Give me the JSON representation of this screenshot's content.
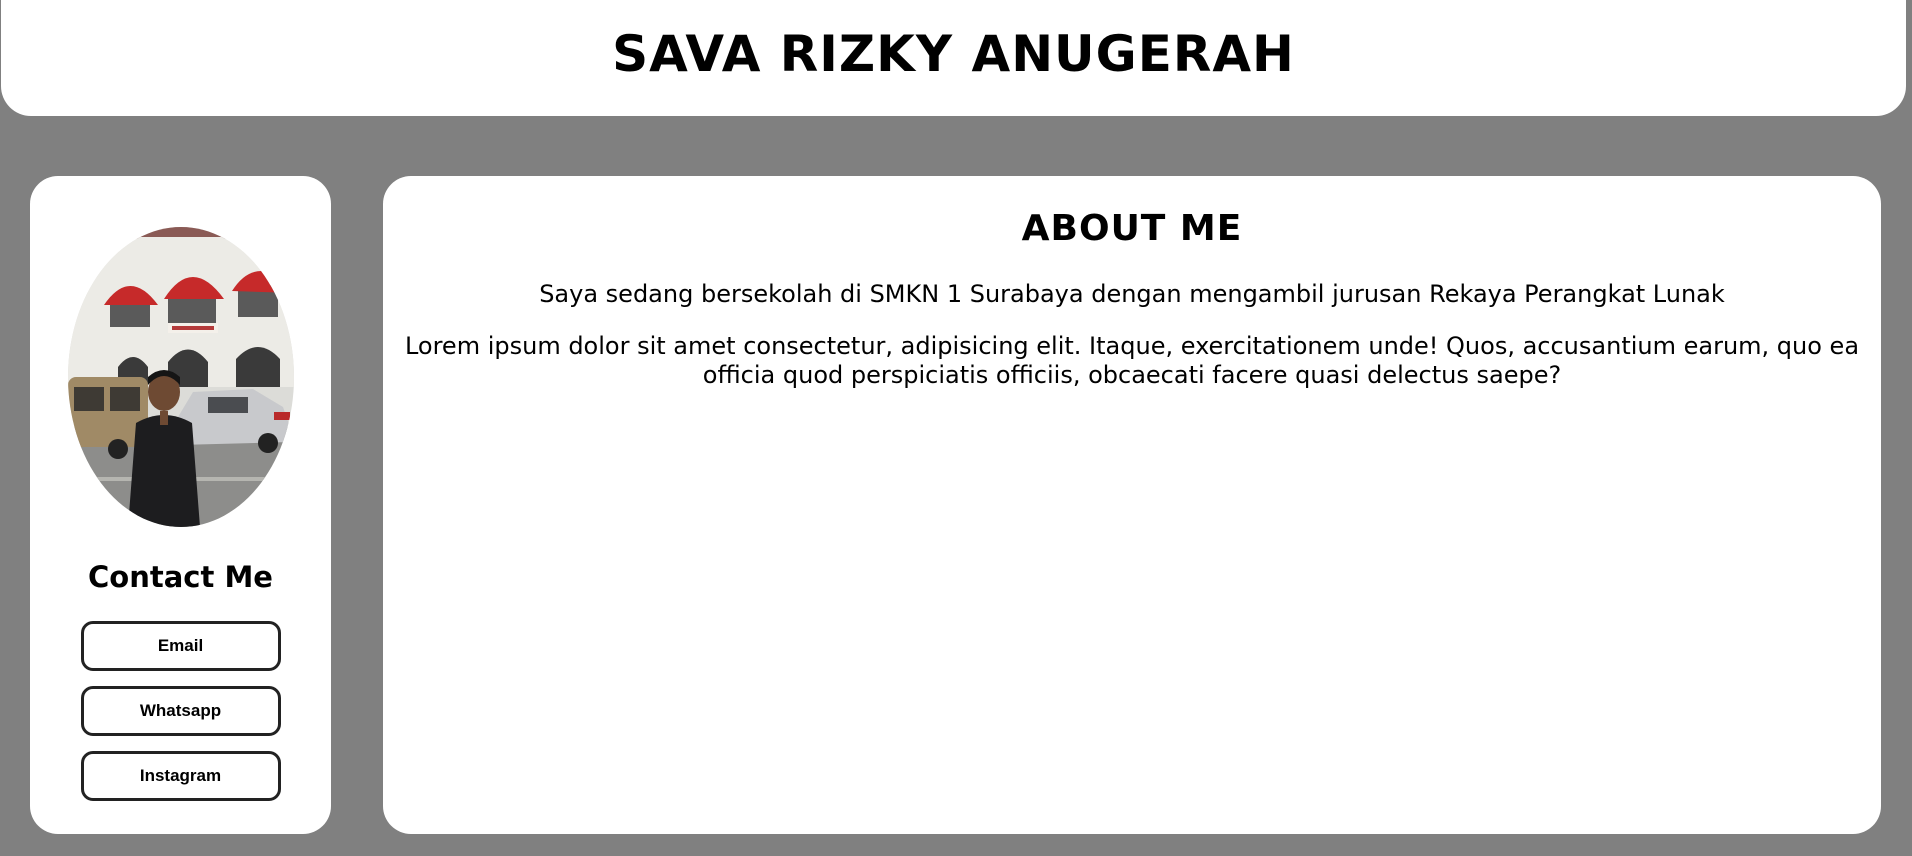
{
  "header": {
    "title": "SAVA RIZKY ANUGERAH"
  },
  "sidebar": {
    "contact_title": "Contact Me",
    "buttons": {
      "email": "Email",
      "whatsapp": "Whatsapp",
      "instagram": "Instagram"
    }
  },
  "main": {
    "heading": "ABOUT ME",
    "paragraph1": "Saya sedang bersekolah di SMKN 1 Surabaya dengan mengambil jurusan Rekaya Perangkat Lunak",
    "paragraph2": "Lorem ipsum dolor sit amet consectetur, adipisicing elit. Itaque, exercitationem unde! Quos, accusantium earum, quo ea officia quod perspiciatis officiis, obcaecati facere quasi delectus saepe?"
  },
  "colors": {
    "page_background": "#808080",
    "card_background": "#ffffff",
    "text": "#000000"
  }
}
